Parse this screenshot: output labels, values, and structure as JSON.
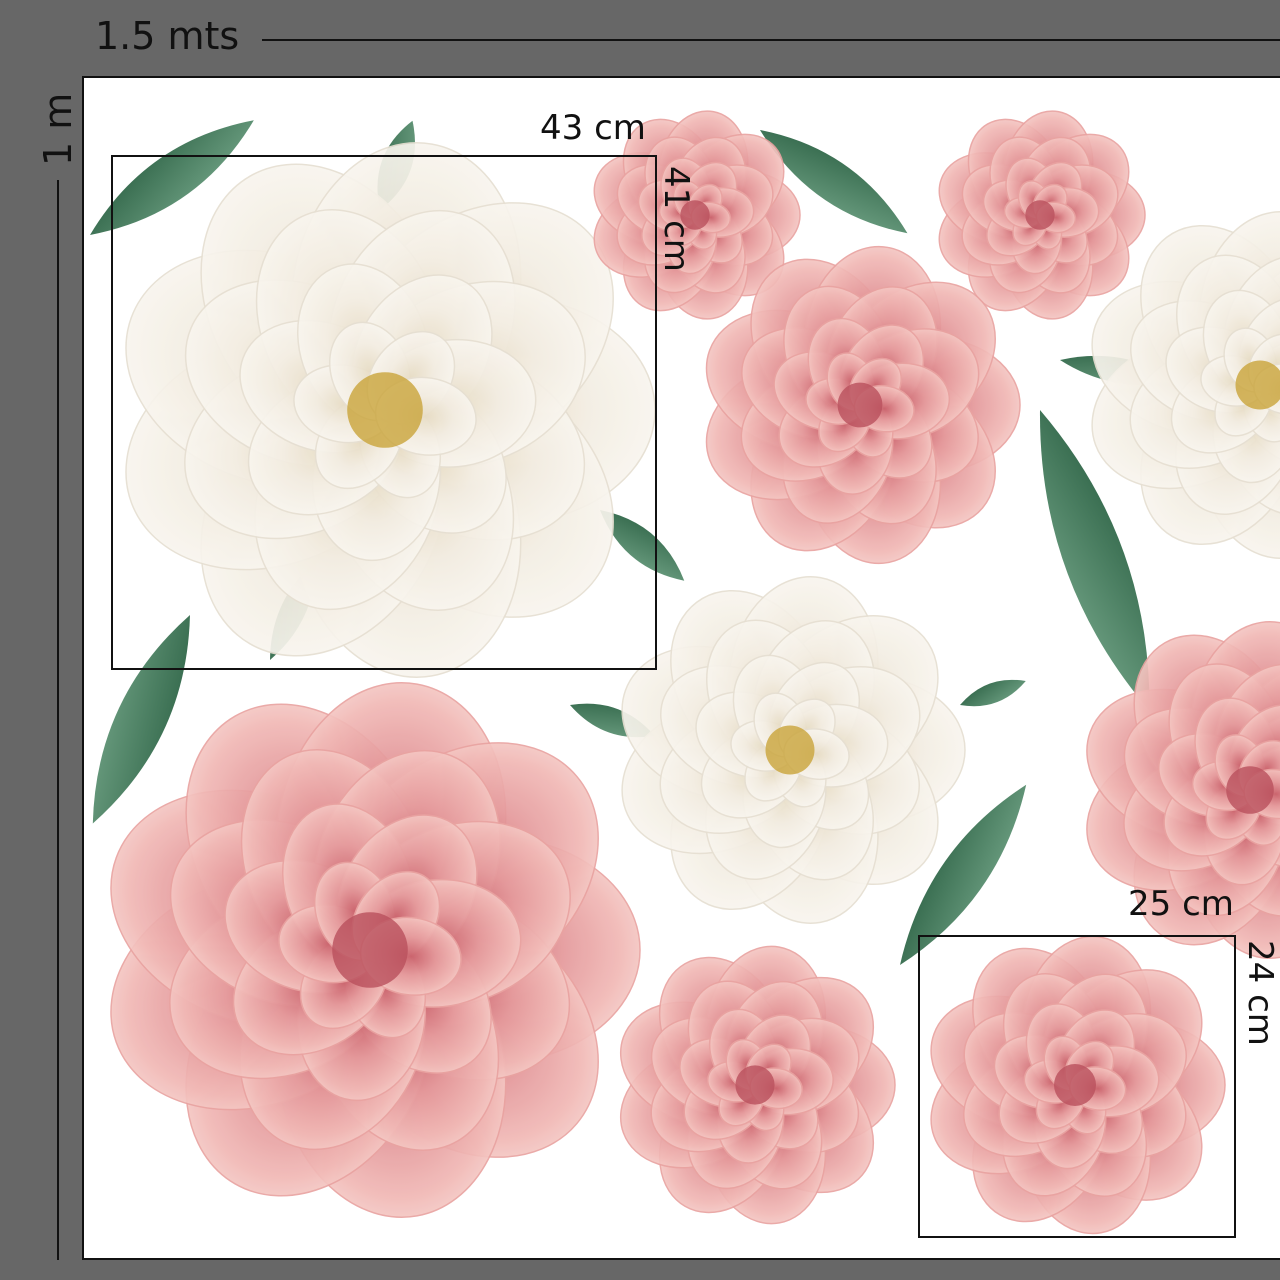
{
  "dimensions": {
    "width": "1.5 mts",
    "height": "1 m"
  },
  "measurements": [
    {
      "id": "large-white-peony",
      "width": "43 cm",
      "height": "41 cm"
    },
    {
      "id": "small-pink-peony",
      "width": "25 cm",
      "height": "24 cm"
    }
  ],
  "colors": {
    "background": "#676767",
    "sheet": "#ffffff",
    "pink_petal": "#eba6a6",
    "pink_deep": "#d97f7f",
    "white_petal": "#f3ede2",
    "leaf": "#3f7a5a"
  },
  "illustration": {
    "subject": "watercolor peonies and leaves"
  }
}
